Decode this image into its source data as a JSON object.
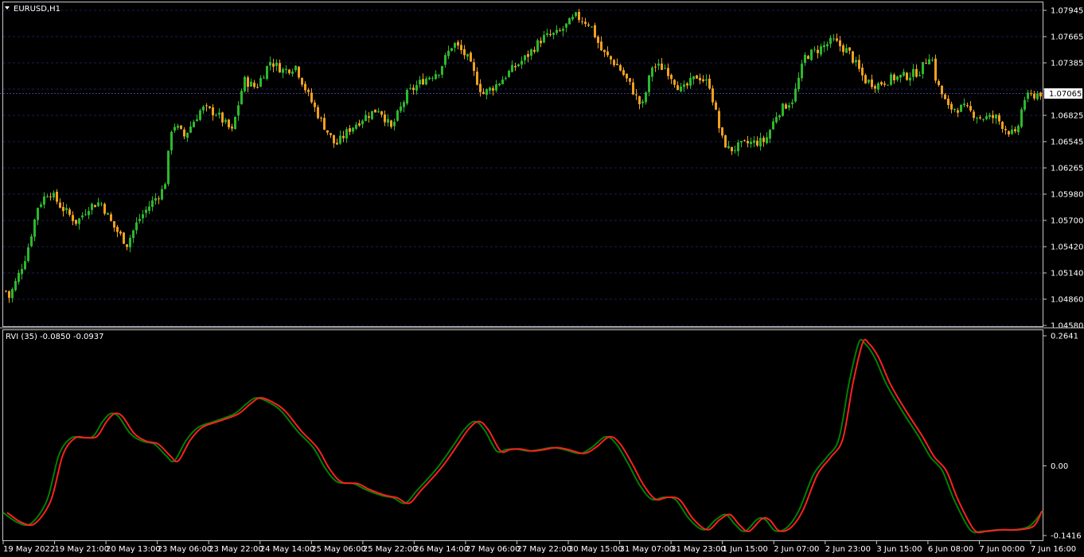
{
  "window": {
    "symbol_title": "EURUSD,H1",
    "indicator_title": "RVI (35) -0.0850 -0.0937"
  },
  "colors": {
    "background": "#000000",
    "bull_candle": "#2db82d",
    "bear_candle": "#f0a020",
    "rvi_main": "#008000",
    "rvi_signal": "#ff2020",
    "grid": "#1c1c5a",
    "current_price_line": "#3a3a9a"
  },
  "chart_data": [
    {
      "type": "candlestick",
      "symbol": "EURUSD",
      "timeframe": "H1",
      "ylim": [
        1.0458,
        1.07945
      ],
      "y_ticks": [
        "1.07945",
        "1.07665",
        "1.07385",
        "1.07065",
        "1.06825",
        "1.06545",
        "1.06265",
        "1.05980",
        "1.05700",
        "1.05420",
        "1.05140",
        "1.04860",
        "1.04580"
      ],
      "current_price": "1.07065",
      "close_path": [
        {
          "x": 0,
          "y": 1.0505
        },
        {
          "x": 10,
          "y": 1.0488
        },
        {
          "x": 20,
          "y": 1.0508
        },
        {
          "x": 32,
          "y": 1.0535
        },
        {
          "x": 46,
          "y": 1.0585
        },
        {
          "x": 60,
          "y": 1.0602
        },
        {
          "x": 75,
          "y": 1.0585
        },
        {
          "x": 95,
          "y": 1.0568
        },
        {
          "x": 110,
          "y": 1.0585
        },
        {
          "x": 125,
          "y": 1.059
        },
        {
          "x": 140,
          "y": 1.0565
        },
        {
          "x": 158,
          "y": 1.0545
        },
        {
          "x": 172,
          "y": 1.057
        },
        {
          "x": 190,
          "y": 1.059
        },
        {
          "x": 205,
          "y": 1.0605
        },
        {
          "x": 215,
          "y": 1.0675
        },
        {
          "x": 230,
          "y": 1.066
        },
        {
          "x": 252,
          "y": 1.069
        },
        {
          "x": 270,
          "y": 1.0685
        },
        {
          "x": 290,
          "y": 1.0665
        },
        {
          "x": 305,
          "y": 1.072
        },
        {
          "x": 320,
          "y": 1.0712
        },
        {
          "x": 338,
          "y": 1.074
        },
        {
          "x": 355,
          "y": 1.073
        },
        {
          "x": 370,
          "y": 1.0735
        },
        {
          "x": 385,
          "y": 1.0705
        },
        {
          "x": 400,
          "y": 1.068
        },
        {
          "x": 420,
          "y": 1.065
        },
        {
          "x": 438,
          "y": 1.0668
        },
        {
          "x": 455,
          "y": 1.068
        },
        {
          "x": 475,
          "y": 1.069
        },
        {
          "x": 490,
          "y": 1.0668
        },
        {
          "x": 510,
          "y": 1.0705
        },
        {
          "x": 530,
          "y": 1.072
        },
        {
          "x": 550,
          "y": 1.073
        },
        {
          "x": 568,
          "y": 1.076
        },
        {
          "x": 585,
          "y": 1.0745
        },
        {
          "x": 605,
          "y": 1.0705
        },
        {
          "x": 622,
          "y": 1.0715
        },
        {
          "x": 640,
          "y": 1.073
        },
        {
          "x": 660,
          "y": 1.0745
        },
        {
          "x": 680,
          "y": 1.0765
        },
        {
          "x": 700,
          "y": 1.077
        },
        {
          "x": 722,
          "y": 1.0788
        },
        {
          "x": 740,
          "y": 1.078
        },
        {
          "x": 755,
          "y": 1.075
        },
        {
          "x": 775,
          "y": 1.0735
        },
        {
          "x": 790,
          "y": 1.0715
        },
        {
          "x": 805,
          "y": 1.069
        },
        {
          "x": 818,
          "y": 1.0735
        },
        {
          "x": 835,
          "y": 1.0733
        },
        {
          "x": 855,
          "y": 1.0708
        },
        {
          "x": 875,
          "y": 1.0725
        },
        {
          "x": 890,
          "y": 1.0715
        },
        {
          "x": 905,
          "y": 1.0658
        },
        {
          "x": 915,
          "y": 1.0645
        },
        {
          "x": 935,
          "y": 1.0652
        },
        {
          "x": 960,
          "y": 1.0655
        },
        {
          "x": 975,
          "y": 1.0685
        },
        {
          "x": 995,
          "y": 1.07
        },
        {
          "x": 1010,
          "y": 1.0745
        },
        {
          "x": 1025,
          "y": 1.0752
        },
        {
          "x": 1045,
          "y": 1.0762
        },
        {
          "x": 1065,
          "y": 1.075
        },
        {
          "x": 1085,
          "y": 1.072
        },
        {
          "x": 1100,
          "y": 1.0715
        },
        {
          "x": 1120,
          "y": 1.0722
        },
        {
          "x": 1140,
          "y": 1.0725
        },
        {
          "x": 1155,
          "y": 1.073
        },
        {
          "x": 1168,
          "y": 1.075
        },
        {
          "x": 1175,
          "y": 1.0718
        },
        {
          "x": 1190,
          "y": 1.069
        },
        {
          "x": 1210,
          "y": 1.069
        },
        {
          "x": 1230,
          "y": 1.068
        },
        {
          "x": 1250,
          "y": 1.068
        },
        {
          "x": 1262,
          "y": 1.0668
        },
        {
          "x": 1275,
          "y": 1.066
        },
        {
          "x": 1285,
          "y": 1.07
        },
        {
          "x": 1300,
          "y": 1.0705
        },
        {
          "x": 1306,
          "y": 1.0706
        }
      ],
      "x_labels": [
        "19 May 2022",
        "19 May 21:00",
        "20 May 13:00",
        "23 May 06:00",
        "23 May 22:00",
        "24 May 14:00",
        "25 May 06:00",
        "25 May 22:00",
        "26 May 14:00",
        "27 May 06:00",
        "27 May 22:00",
        "30 May 15:00",
        "31 May 07:00",
        "31 May 23:00",
        "1 Jun 15:00",
        "2 Jun 07:00",
        "2 Jun 23:00",
        "3 Jun 15:00",
        "6 Jun 08:00",
        "7 Jun 00:00",
        "7 Jun 16:00"
      ]
    },
    {
      "type": "line",
      "indicator": "RVI",
      "period": 35,
      "ylim": [
        -0.1416,
        0.2641
      ],
      "y_ticks": [
        "0.2641",
        "0.00",
        "-0.1416"
      ],
      "series": [
        {
          "name": "RVI",
          "points": [
            {
              "x": 0,
              "y": -0.095
            },
            {
              "x": 18,
              "y": -0.115
            },
            {
              "x": 35,
              "y": -0.117
            },
            {
              "x": 55,
              "y": -0.07
            },
            {
              "x": 70,
              "y": 0.022
            },
            {
              "x": 85,
              "y": 0.056
            },
            {
              "x": 100,
              "y": 0.057
            },
            {
              "x": 113,
              "y": 0.06
            },
            {
              "x": 125,
              "y": 0.09
            },
            {
              "x": 135,
              "y": 0.106
            },
            {
              "x": 145,
              "y": 0.1
            },
            {
              "x": 160,
              "y": 0.065
            },
            {
              "x": 175,
              "y": 0.05
            },
            {
              "x": 190,
              "y": 0.044
            },
            {
              "x": 205,
              "y": 0.02
            },
            {
              "x": 215,
              "y": 0.01
            },
            {
              "x": 230,
              "y": 0.052
            },
            {
              "x": 245,
              "y": 0.078
            },
            {
              "x": 265,
              "y": 0.09
            },
            {
              "x": 290,
              "y": 0.105
            },
            {
              "x": 305,
              "y": 0.125
            },
            {
              "x": 318,
              "y": 0.138
            },
            {
              "x": 335,
              "y": 0.128
            },
            {
              "x": 350,
              "y": 0.11
            },
            {
              "x": 370,
              "y": 0.07
            },
            {
              "x": 390,
              "y": 0.036
            },
            {
              "x": 405,
              "y": -0.006
            },
            {
              "x": 420,
              "y": -0.033
            },
            {
              "x": 440,
              "y": -0.036
            },
            {
              "x": 455,
              "y": -0.048
            },
            {
              "x": 475,
              "y": -0.06
            },
            {
              "x": 490,
              "y": -0.065
            },
            {
              "x": 505,
              "y": -0.076
            },
            {
              "x": 520,
              "y": -0.05
            },
            {
              "x": 545,
              "y": -0.005
            },
            {
              "x": 565,
              "y": 0.04
            },
            {
              "x": 580,
              "y": 0.075
            },
            {
              "x": 593,
              "y": 0.09
            },
            {
              "x": 605,
              "y": 0.072
            },
            {
              "x": 620,
              "y": 0.03
            },
            {
              "x": 632,
              "y": 0.033
            },
            {
              "x": 645,
              "y": 0.034
            },
            {
              "x": 660,
              "y": 0.03
            },
            {
              "x": 675,
              "y": 0.033
            },
            {
              "x": 690,
              "y": 0.037
            },
            {
              "x": 705,
              "y": 0.033
            },
            {
              "x": 725,
              "y": 0.025
            },
            {
              "x": 740,
              "y": 0.038
            },
            {
              "x": 757,
              "y": 0.059
            },
            {
              "x": 770,
              "y": 0.045
            },
            {
              "x": 785,
              "y": 0.005
            },
            {
              "x": 800,
              "y": -0.04
            },
            {
              "x": 815,
              "y": -0.068
            },
            {
              "x": 830,
              "y": -0.064
            },
            {
              "x": 845,
              "y": -0.069
            },
            {
              "x": 862,
              "y": -0.108
            },
            {
              "x": 880,
              "y": -0.13
            },
            {
              "x": 895,
              "y": -0.11
            },
            {
              "x": 908,
              "y": -0.099
            },
            {
              "x": 920,
              "y": -0.12
            },
            {
              "x": 932,
              "y": -0.133
            },
            {
              "x": 948,
              "y": -0.108
            },
            {
              "x": 958,
              "y": -0.11
            },
            {
              "x": 970,
              "y": -0.132
            },
            {
              "x": 985,
              "y": -0.125
            },
            {
              "x": 1000,
              "y": -0.09
            },
            {
              "x": 1018,
              "y": -0.018
            },
            {
              "x": 1035,
              "y": 0.018
            },
            {
              "x": 1050,
              "y": 0.055
            },
            {
              "x": 1063,
              "y": 0.17
            },
            {
              "x": 1075,
              "y": 0.25
            },
            {
              "x": 1083,
              "y": 0.248
            },
            {
              "x": 1095,
              "y": 0.22
            },
            {
              "x": 1110,
              "y": 0.165
            },
            {
              "x": 1130,
              "y": 0.11
            },
            {
              "x": 1150,
              "y": 0.06
            },
            {
              "x": 1165,
              "y": 0.018
            },
            {
              "x": 1180,
              "y": -0.01
            },
            {
              "x": 1195,
              "y": -0.07
            },
            {
              "x": 1215,
              "y": -0.13
            },
            {
              "x": 1230,
              "y": -0.133
            },
            {
              "x": 1250,
              "y": -0.13
            },
            {
              "x": 1270,
              "y": -0.13
            },
            {
              "x": 1290,
              "y": -0.122
            },
            {
              "x": 1306,
              "y": -0.092
            }
          ]
        },
        {
          "name": "Signal",
          "lag": 5
        }
      ]
    }
  ]
}
